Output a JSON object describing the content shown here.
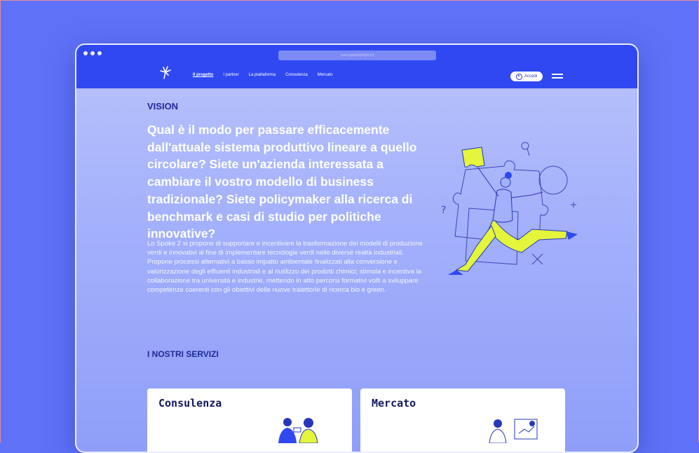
{
  "browser": {
    "url": "www.spoke2project.it"
  },
  "nav": {
    "items": [
      "Il progetto",
      "I partner",
      "La piattaforma",
      "Consulenza",
      "Mercato"
    ],
    "active_index": 0,
    "login_label": "Accedi"
  },
  "vision": {
    "heading": "VISION",
    "question": "Qual è il modo per passare efficacemente dall'attuale sistema produttivo lineare a quello circolare? Siete un'azienda interessata a cambiare il vostro modello di business tradizionale? Siete policymaker alla ricerca di benchmark e casi di studio per politiche innovative?",
    "body_p1": "Lo Spoke 2 si propone di supportare e incentivare la trasformazione dei modelli di produzione verdi e innovativi al fine di implementare tecnologie verdi nelle diverse realtà industriali.",
    "body_p2": "Propone processi alternativi a basso impatto ambientale finalizzati alla conversione e valorizzazione degli effluenti industriali e al riutilizzo dei prodotti chimici; stimola e incentiva la collaborazione tra università e industrie, mettendo in atto percorsi formativi volti a sviluppare competenze coerenti con gli obiettivi delle nuove traiettorie di ricerca bio e green."
  },
  "services": {
    "heading": "I NOSTRI SERVIZI",
    "cards": [
      {
        "title": "Consulenza",
        "icon": "meeting-people-illustration"
      },
      {
        "title": "Mercato",
        "icon": "market-screen-illustration"
      }
    ]
  },
  "colors": {
    "background": "#5f72f7",
    "nav_bar": "#3048f2",
    "accent_lime": "#e4f53c",
    "heading_navy": "#1f2a96"
  },
  "icons": [
    "logo-icon",
    "user-icon",
    "menu-icon",
    "puzzle-person-illustration"
  ]
}
